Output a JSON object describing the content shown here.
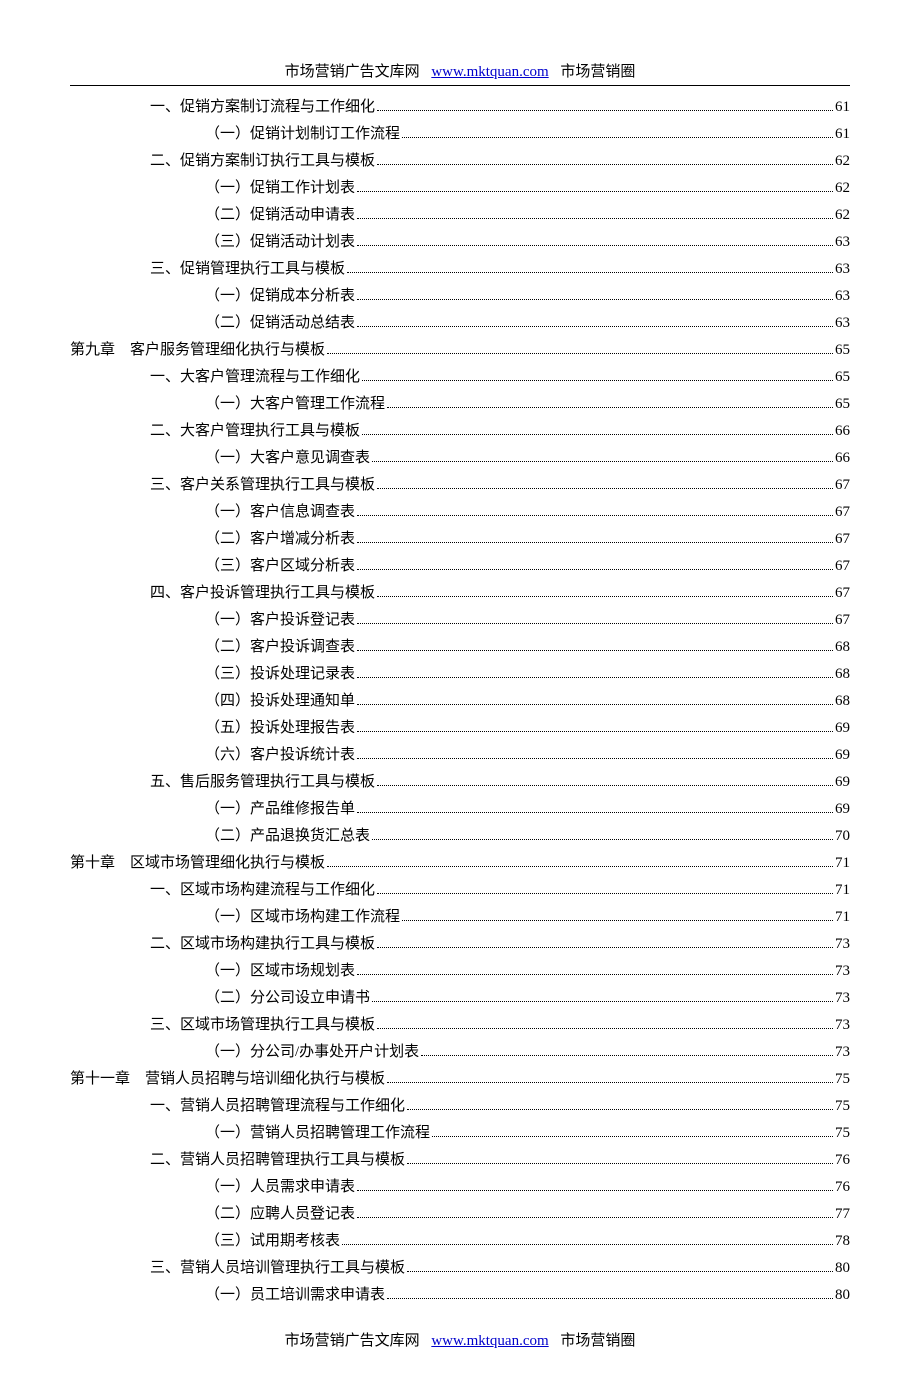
{
  "header": {
    "left": "市场营销广告文库网",
    "link_text": "www.mktquan.com",
    "link_href": "http://www.mktquan.com",
    "right": "市场营销圈"
  },
  "footer": {
    "left": "市场营销广告文库网",
    "link_text": "www.mktquan.com",
    "link_href": "http://www.mktquan.com",
    "right": "市场营销圈"
  },
  "toc": [
    {
      "level": 1,
      "label": "一、促销方案制订流程与工作细化",
      "page": "61"
    },
    {
      "level": 2,
      "label": "（一）促销计划制订工作流程",
      "page": "61"
    },
    {
      "level": 1,
      "label": "二、促销方案制订执行工具与模板",
      "page": "62"
    },
    {
      "level": 2,
      "label": "（一）促销工作计划表",
      "page": "62"
    },
    {
      "level": 2,
      "label": "（二）促销活动申请表",
      "page": "62"
    },
    {
      "level": 2,
      "label": "（三）促销活动计划表",
      "page": "63"
    },
    {
      "level": 1,
      "label": "三、促销管理执行工具与模板",
      "page": "63"
    },
    {
      "level": 2,
      "label": "（一）促销成本分析表",
      "page": "63"
    },
    {
      "level": 2,
      "label": "（二）促销活动总结表",
      "page": "63"
    },
    {
      "level": 0,
      "label": "第九章　客户服务管理细化执行与模板",
      "page": "65"
    },
    {
      "level": 1,
      "label": "一、大客户管理流程与工作细化",
      "page": "65"
    },
    {
      "level": 2,
      "label": "（一）大客户管理工作流程",
      "page": "65"
    },
    {
      "level": 1,
      "label": "二、大客户管理执行工具与模板",
      "page": "66"
    },
    {
      "level": 2,
      "label": "（一）大客户意见调查表",
      "page": "66"
    },
    {
      "level": 1,
      "label": "三、客户关系管理执行工具与模板",
      "page": "67"
    },
    {
      "level": 2,
      "label": "（一）客户信息调查表",
      "page": "67"
    },
    {
      "level": 2,
      "label": "（二）客户增减分析表",
      "page": "67"
    },
    {
      "level": 2,
      "label": "（三）客户区域分析表",
      "page": "67"
    },
    {
      "level": 1,
      "label": "四、客户投诉管理执行工具与模板",
      "page": "67"
    },
    {
      "level": 2,
      "label": "（一）客户投诉登记表",
      "page": "67"
    },
    {
      "level": 2,
      "label": "（二）客户投诉调查表",
      "page": "68"
    },
    {
      "level": 2,
      "label": "（三）投诉处理记录表",
      "page": "68"
    },
    {
      "level": 2,
      "label": "（四）投诉处理通知单",
      "page": "68"
    },
    {
      "level": 2,
      "label": "（五）投诉处理报告表",
      "page": "69"
    },
    {
      "level": 2,
      "label": "（六）客户投诉统计表",
      "page": "69"
    },
    {
      "level": 1,
      "label": "五、售后服务管理执行工具与模板",
      "page": "69"
    },
    {
      "level": 2,
      "label": "（一）产品维修报告单",
      "page": "69"
    },
    {
      "level": 2,
      "label": "（二）产品退换货汇总表",
      "page": "70"
    },
    {
      "level": 0,
      "label": "第十章　区域市场管理细化执行与模板",
      "page": "71"
    },
    {
      "level": 1,
      "label": "一、区域市场构建流程与工作细化",
      "page": "71"
    },
    {
      "level": 2,
      "label": "（一）区域市场构建工作流程",
      "page": "71"
    },
    {
      "level": 1,
      "label": "二、区域市场构建执行工具与模板",
      "page": "73"
    },
    {
      "level": 2,
      "label": "（一）区域市场规划表",
      "page": "73"
    },
    {
      "level": 2,
      "label": "（二）分公司设立申请书",
      "page": "73"
    },
    {
      "level": 1,
      "label": "三、区域市场管理执行工具与模板",
      "page": "73"
    },
    {
      "level": 2,
      "label": "（一）分公司/办事处开户计划表 ",
      "page": "73"
    },
    {
      "level": 0,
      "label": "第十一章　营销人员招聘与培训细化执行与模板",
      "page": "75"
    },
    {
      "level": 1,
      "label": "一、营销人员招聘管理流程与工作细化",
      "page": "75"
    },
    {
      "level": 2,
      "label": "（一）营销人员招聘管理工作流程",
      "page": "75"
    },
    {
      "level": 1,
      "label": "二、营销人员招聘管理执行工具与模板",
      "page": "76"
    },
    {
      "level": 2,
      "label": "（一）人员需求申请表",
      "page": "76"
    },
    {
      "level": 2,
      "label": "（二）应聘人员登记表",
      "page": "77"
    },
    {
      "level": 2,
      "label": "（三）试用期考核表",
      "page": "78"
    },
    {
      "level": 1,
      "label": "三、营销人员培训管理执行工具与模板",
      "page": "80"
    },
    {
      "level": 2,
      "label": "（一）员工培训需求申请表",
      "page": "80"
    }
  ]
}
